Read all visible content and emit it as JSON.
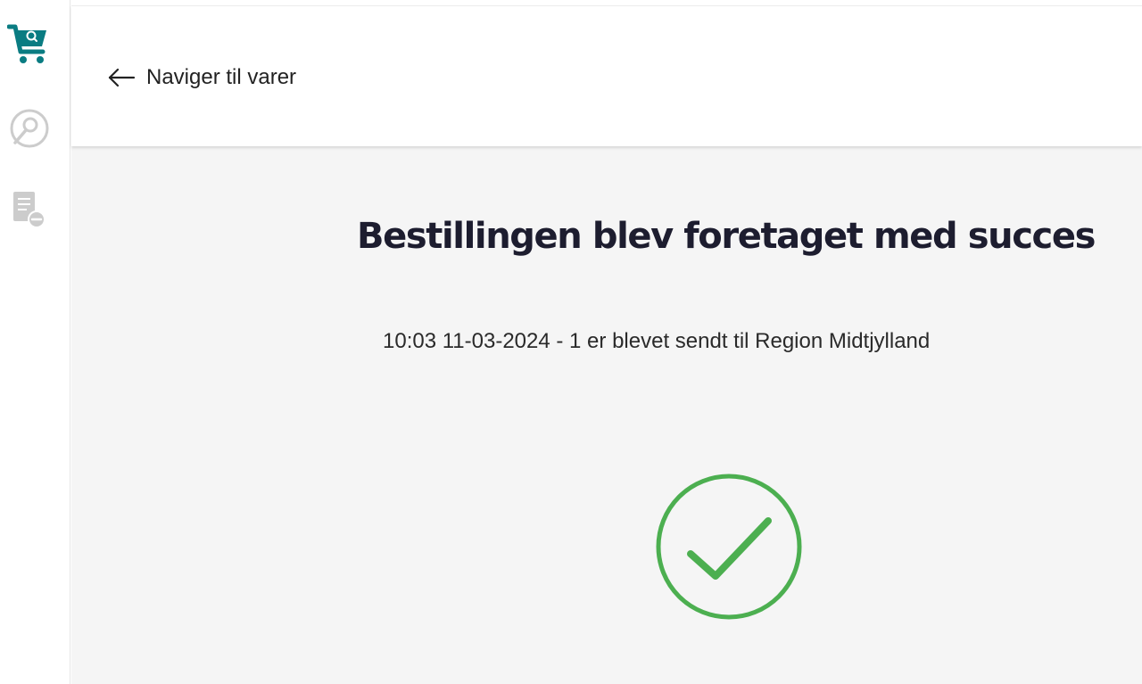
{
  "sidebar": {
    "items": [
      {
        "icon": "cart-search-icon",
        "color": "#0a7c82",
        "active": true
      },
      {
        "icon": "search-circle-icon",
        "color": "#c9c9c9",
        "active": false
      },
      {
        "icon": "document-remove-icon",
        "color": "#c9c9c9",
        "active": false
      }
    ]
  },
  "header": {
    "back_label": "Naviger til varer",
    "back_icon": "arrow-left-icon"
  },
  "main": {
    "title": "Bestillingen blev foretaget med succes",
    "message": "10:03 11-03-2024 - 1 er blevet sendt til Region Midtjylland",
    "status_icon": "success-check-icon",
    "status_color": "#4caf50"
  }
}
